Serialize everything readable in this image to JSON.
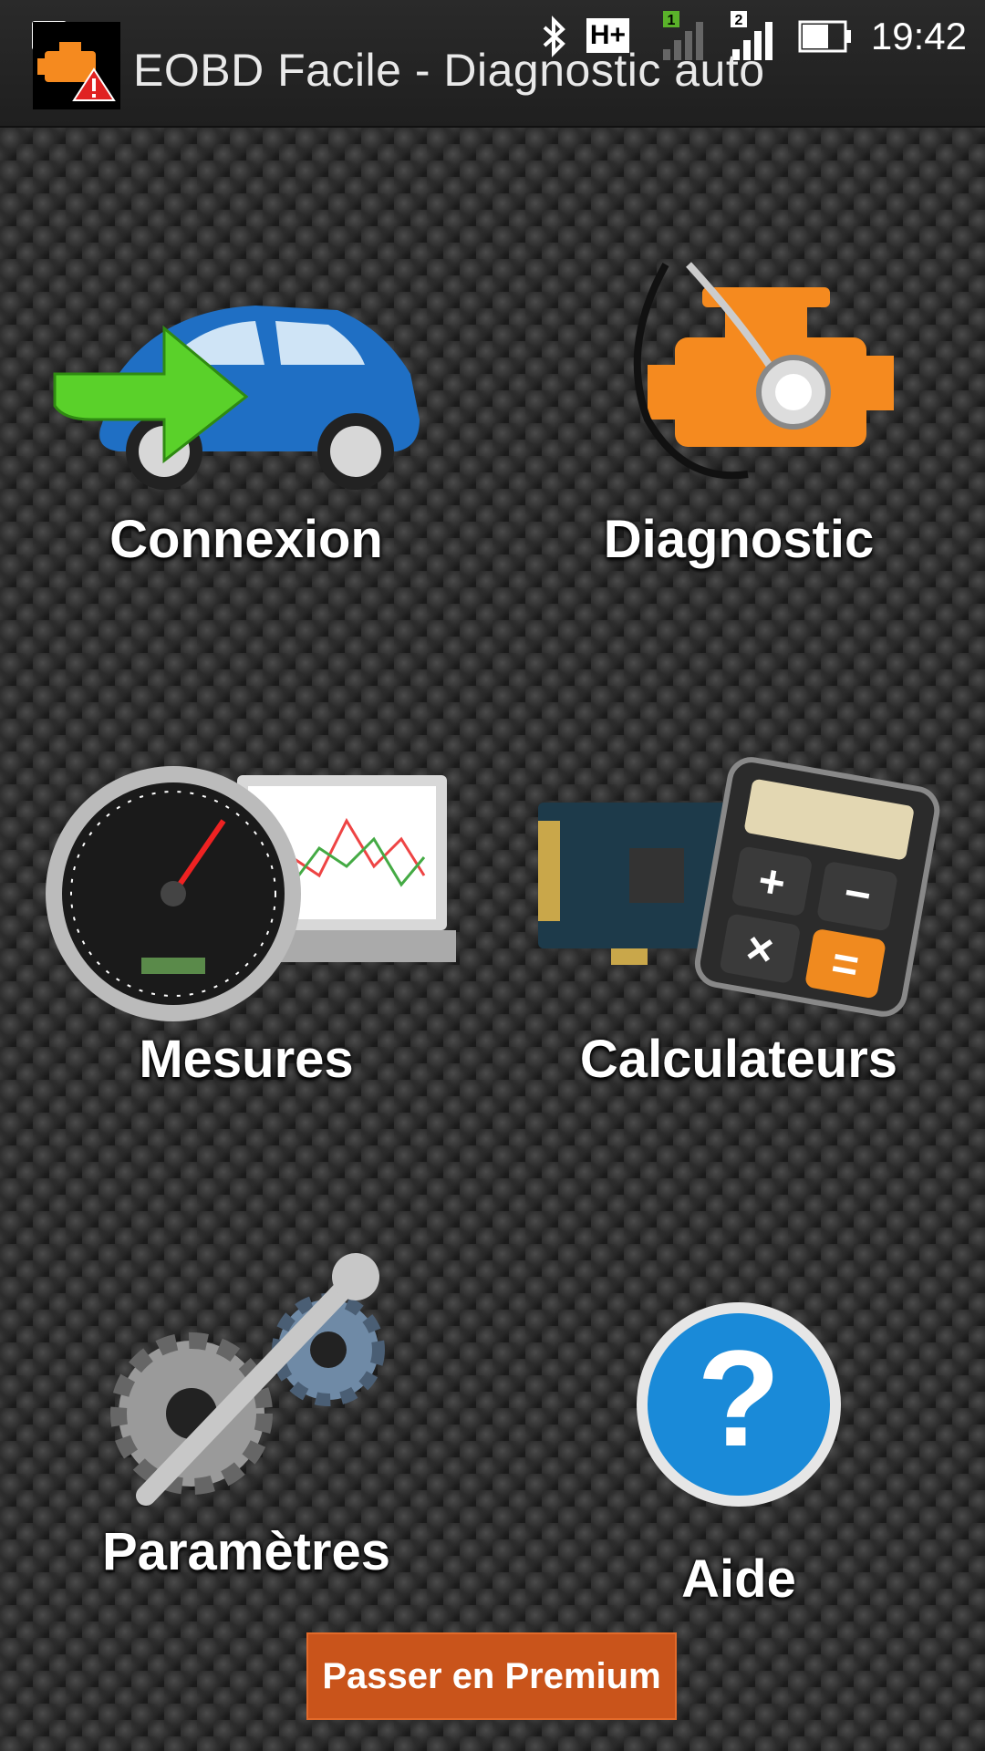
{
  "status_bar": {
    "time": "19:42",
    "network_type": "H+",
    "sim1_label": "1",
    "sim2_label": "2"
  },
  "app_bar": {
    "title": "EOBD Facile - Diagnostic auto"
  },
  "menu": {
    "items": [
      {
        "label": "Connexion",
        "icon": "car-connect-icon"
      },
      {
        "label": "Diagnostic",
        "icon": "engine-stethoscope-icon"
      },
      {
        "label": "Mesures",
        "icon": "speedometer-laptop-icon"
      },
      {
        "label": "Calculateurs",
        "icon": "ecu-calculator-icon"
      },
      {
        "label": "Paramètres",
        "icon": "gears-wrench-icon"
      },
      {
        "label": "Aide",
        "icon": "help-icon"
      }
    ]
  },
  "premium_button": {
    "label": "Passer en Premium"
  },
  "colors": {
    "accent": "#c9541b",
    "engine_orange": "#f58a1f",
    "arrow_green": "#5ad12a",
    "car_blue": "#1f6fc4",
    "help_blue": "#1a8ad8"
  }
}
